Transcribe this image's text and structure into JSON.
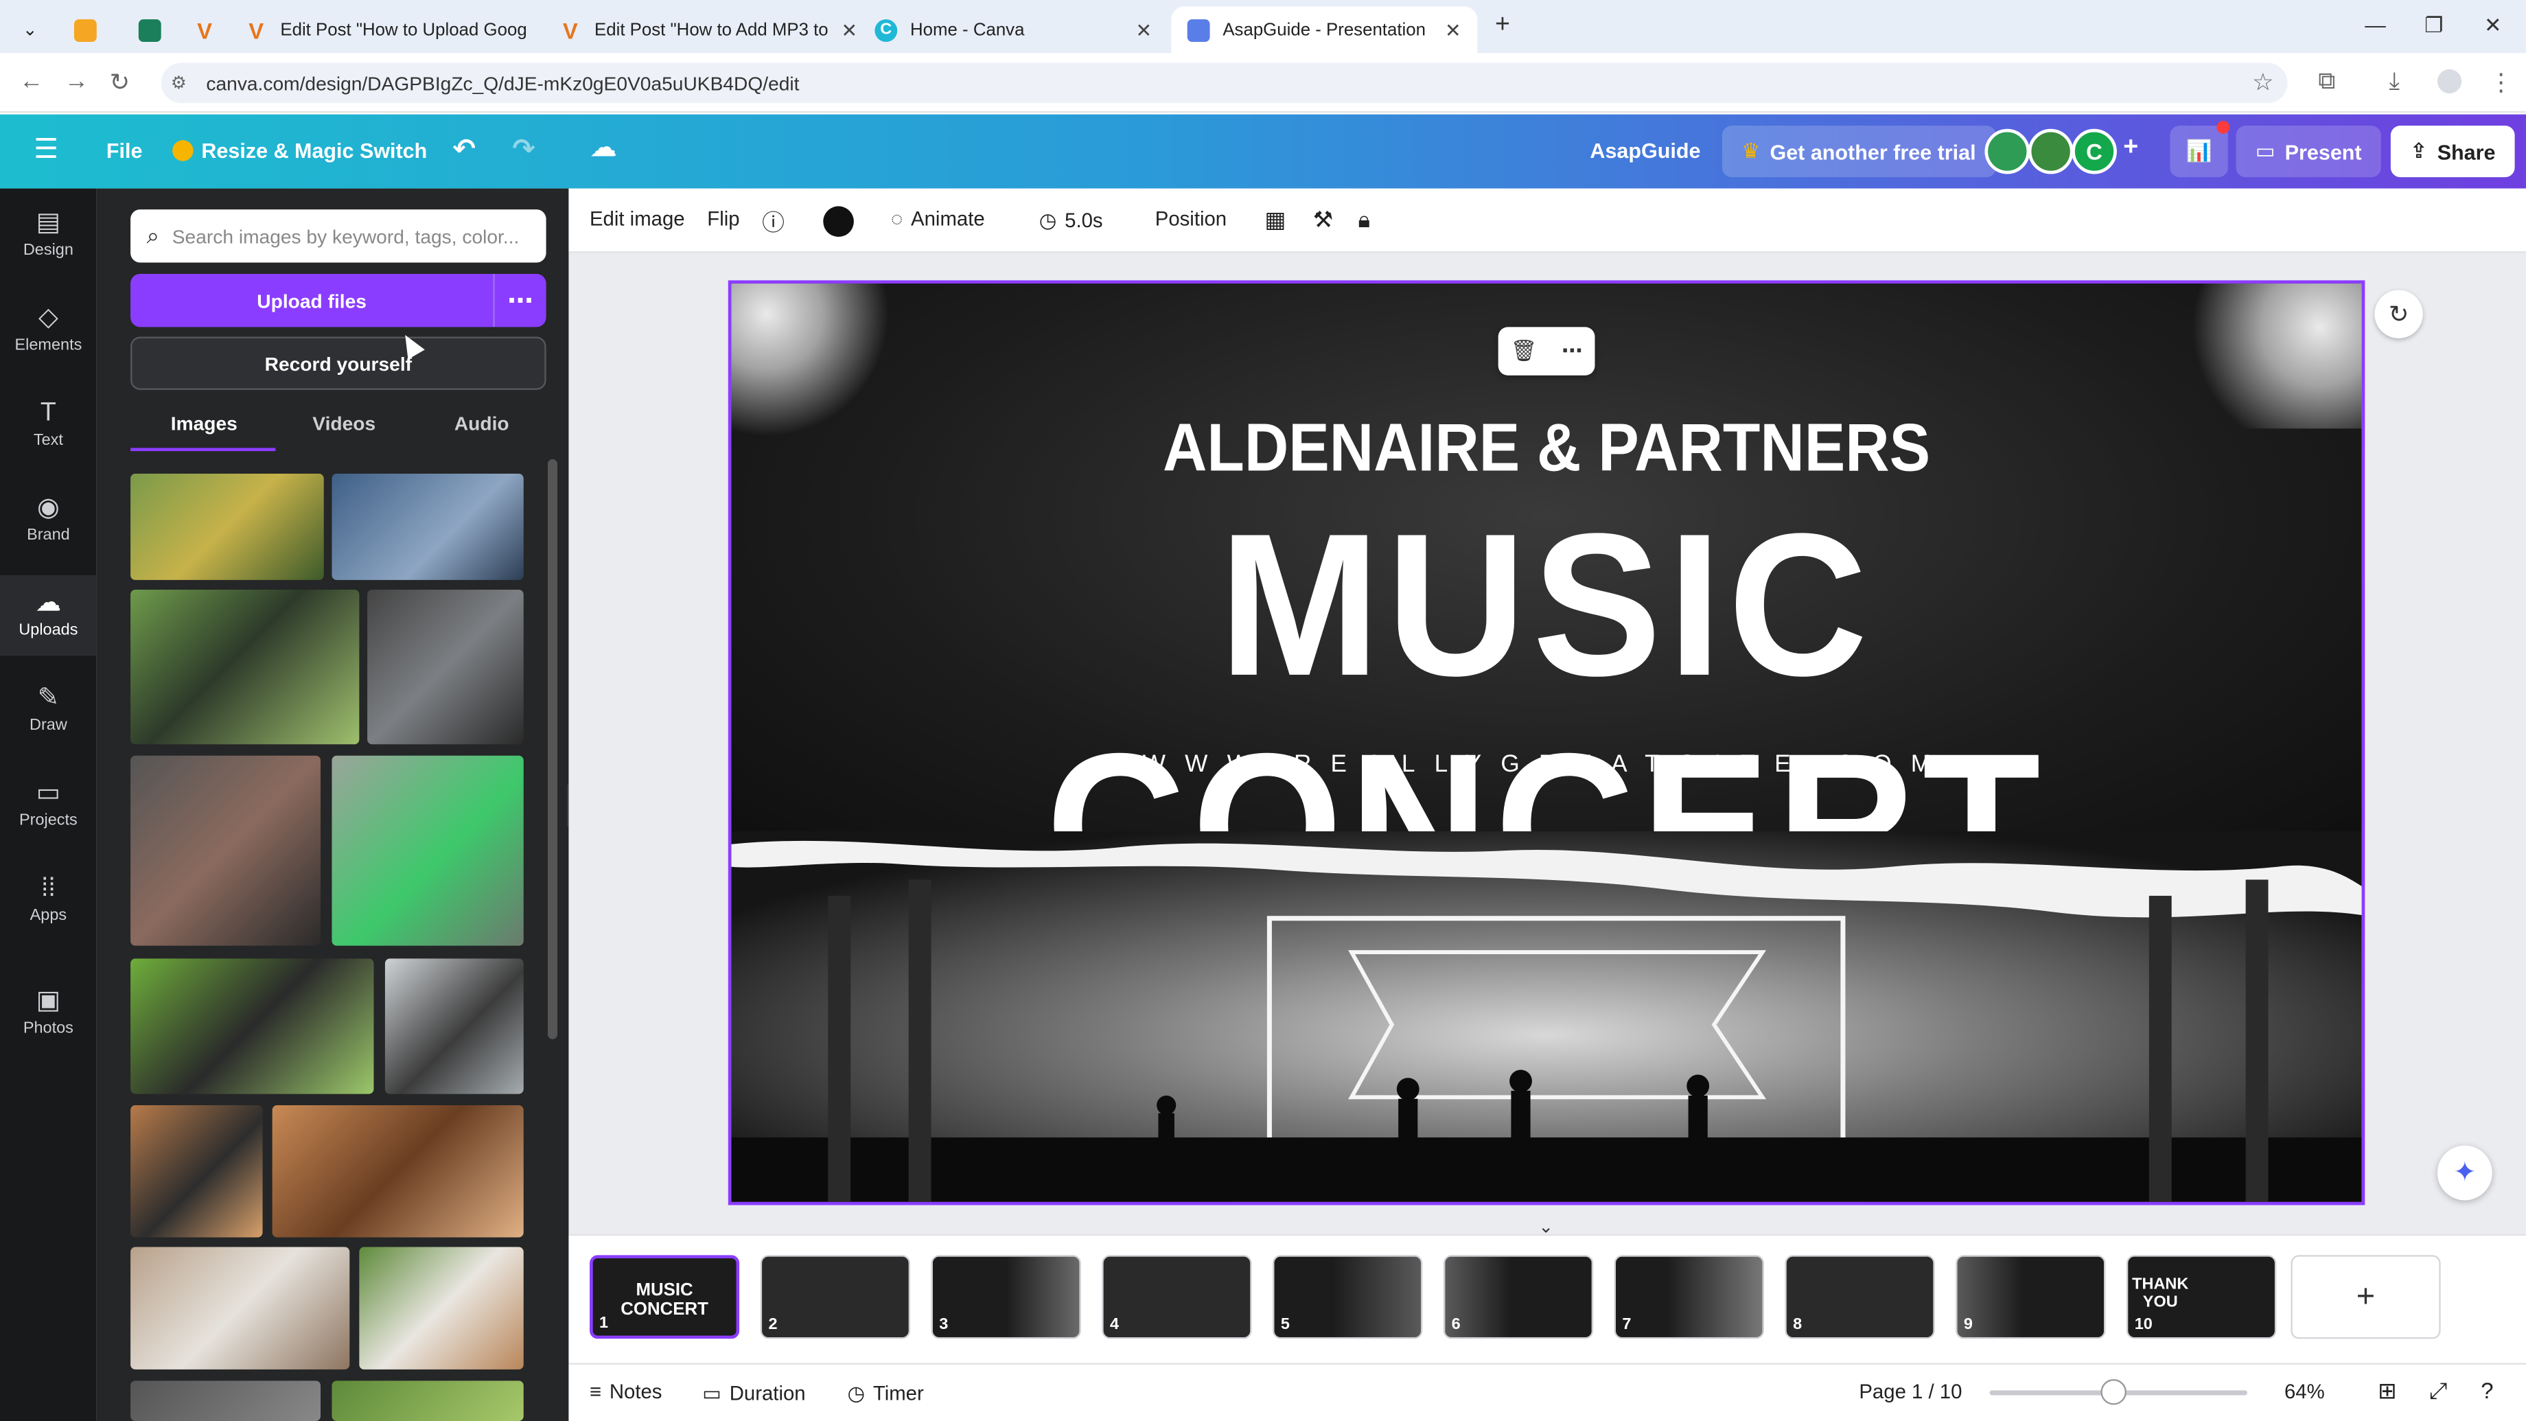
{
  "browser": {
    "tabs": [
      {
        "label": ""
      },
      {
        "label": ""
      },
      {
        "label": ""
      },
      {
        "label": "Edit Post \"How to Upload Goog"
      },
      {
        "label": "Edit Post \"How to Add MP3 to"
      },
      {
        "label": "Home - Canva"
      },
      {
        "label": "AsapGuide - Presentation"
      }
    ],
    "url": "canva.com/design/DAGPBIgZc_Q/dJE-mKz0gE0V0a5uUKB4DQ/edit"
  },
  "header": {
    "file_label": "File",
    "resize_label": "Resize & Magic Switch",
    "team_name": "AsapGuide",
    "trial_label": "Get another free trial",
    "avatar_initial": "C",
    "present_label": "Present",
    "share_label": "Share"
  },
  "rail": {
    "items": [
      {
        "label": "Design",
        "icon": "design-icon"
      },
      {
        "label": "Elements",
        "icon": "elements-icon"
      },
      {
        "label": "Text",
        "icon": "text-icon"
      },
      {
        "label": "Brand",
        "icon": "brand-icon"
      },
      {
        "label": "Uploads",
        "icon": "uploads-icon"
      },
      {
        "label": "Draw",
        "icon": "draw-icon"
      },
      {
        "label": "Projects",
        "icon": "projects-icon"
      },
      {
        "label": "Apps",
        "icon": "apps-icon"
      },
      {
        "label": "Photos",
        "icon": "photos-icon"
      }
    ]
  },
  "panel": {
    "search_placeholder": "Search images by keyword, tags, color...",
    "upload_label": "Upload files",
    "record_label": "Record yourself",
    "tabs": [
      {
        "label": "Images"
      },
      {
        "label": "Videos"
      },
      {
        "label": "Audio"
      }
    ]
  },
  "toolbar": {
    "edit_image": "Edit image",
    "flip": "Flip",
    "animate": "Animate",
    "duration": "5.0s",
    "position": "Position"
  },
  "slide": {
    "company": "ALDENAIRE & PARTNERS",
    "title": "MUSIC CONCERT",
    "website": "WWW.REALLYGREATSITE.COM"
  },
  "pages": {
    "items": [
      {
        "num": "1",
        "title": "MUSIC CONCERT"
      },
      {
        "num": "2",
        "title": ""
      },
      {
        "num": "3",
        "title": ""
      },
      {
        "num": "4",
        "title": ""
      },
      {
        "num": "5",
        "title": ""
      },
      {
        "num": "6",
        "title": ""
      },
      {
        "num": "7",
        "title": ""
      },
      {
        "num": "8",
        "title": ""
      },
      {
        "num": "9",
        "title": ""
      },
      {
        "num": "10",
        "title": "THANK YOU"
      }
    ]
  },
  "footer": {
    "notes": "Notes",
    "duration": "Duration",
    "timer": "Timer",
    "page_indicator": "Page 1 / 10",
    "zoom": "64%"
  },
  "colors": {
    "accent": "#8b3dff",
    "header_start": "#1dbdcf",
    "header_end": "#6f3fe0"
  }
}
